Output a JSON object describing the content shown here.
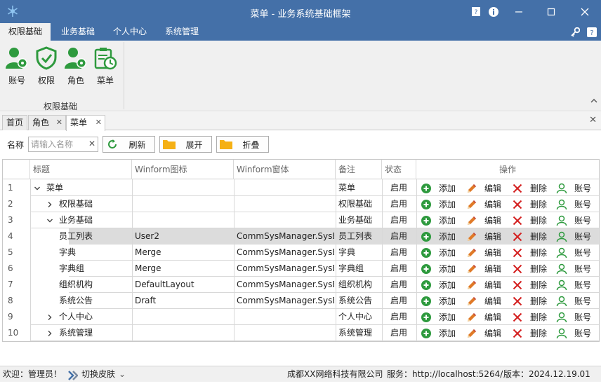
{
  "window": {
    "title": "菜单 - 业务系统基础框架"
  },
  "menu": [
    {
      "label": "权限基础",
      "active": true
    },
    {
      "label": "业务基础",
      "active": false
    },
    {
      "label": "个人中心",
      "active": false
    },
    {
      "label": "系统管理",
      "active": false
    }
  ],
  "ribbon": {
    "buttons": [
      {
        "label": "账号",
        "icon": "user-account-icon"
      },
      {
        "label": "权限",
        "icon": "shield-check-icon"
      },
      {
        "label": "角色",
        "icon": "user-role-icon"
      },
      {
        "label": "菜单",
        "icon": "menu-clock-icon"
      }
    ],
    "group_label": "权限基础"
  },
  "doc_tabs": [
    {
      "label": "首页",
      "closable": false,
      "active": false
    },
    {
      "label": "角色",
      "closable": true,
      "active": false
    },
    {
      "label": "菜单",
      "closable": true,
      "active": true
    }
  ],
  "toolbar": {
    "name_label": "名称",
    "search_placeholder": "请输入名称",
    "refresh_label": "刷新",
    "expand_label": "展开",
    "collapse_label": "折叠"
  },
  "grid": {
    "headers": {
      "title": "标题",
      "icon": "Winform图标",
      "form": "Winform窗体",
      "remark": "备注",
      "status": "状态",
      "actions": "操作"
    },
    "action_labels": {
      "add": "添加",
      "edit": "编辑",
      "delete": "删除",
      "account": "账号"
    },
    "rows": [
      {
        "num": "1",
        "level": 0,
        "toggle": "expanded",
        "title": "菜单",
        "icon": "",
        "form": "",
        "remark": "菜单",
        "status": "启用",
        "selected": false
      },
      {
        "num": "2",
        "level": 1,
        "toggle": "collapsed",
        "title": "权限基础",
        "icon": "",
        "form": "",
        "remark": "权限基础",
        "status": "启用",
        "selected": false
      },
      {
        "num": "3",
        "level": 1,
        "toggle": "expanded",
        "title": "业务基础",
        "icon": "",
        "form": "",
        "remark": "业务基础",
        "status": "启用",
        "selected": false
      },
      {
        "num": "4",
        "level": 2,
        "toggle": "none",
        "title": "员工列表",
        "icon": "User2",
        "form": "CommSysManager.SysB...",
        "remark": "员工列表",
        "status": "启用",
        "selected": true
      },
      {
        "num": "5",
        "level": 2,
        "toggle": "none",
        "title": "字典",
        "icon": "Merge",
        "form": "CommSysManager.SysB...",
        "remark": "字典",
        "status": "启用",
        "selected": false
      },
      {
        "num": "6",
        "level": 2,
        "toggle": "none",
        "title": "字典组",
        "icon": "Merge",
        "form": "CommSysManager.SysB...",
        "remark": "字典组",
        "status": "启用",
        "selected": false
      },
      {
        "num": "7",
        "level": 2,
        "toggle": "none",
        "title": "组织机构",
        "icon": "DefaultLayout",
        "form": "CommSysManager.SysB...",
        "remark": "组织机构",
        "status": "启用",
        "selected": false
      },
      {
        "num": "8",
        "level": 2,
        "toggle": "none",
        "title": "系统公告",
        "icon": "Draft",
        "form": "CommSysManager.SysB...",
        "remark": "系统公告",
        "status": "启用",
        "selected": false
      },
      {
        "num": "9",
        "level": 1,
        "toggle": "collapsed",
        "title": "个人中心",
        "icon": "",
        "form": "",
        "remark": "个人中心",
        "status": "启用",
        "selected": false
      },
      {
        "num": "10",
        "level": 1,
        "toggle": "collapsed",
        "title": "系统管理",
        "icon": "",
        "form": "",
        "remark": "系统管理",
        "status": "启用",
        "selected": false
      }
    ]
  },
  "statusbar": {
    "welcome": "欢迎：管理员！",
    "skin": "切换皮肤",
    "company": "成都XX网络科技有限公司",
    "service": "服务：http://localhost:5264/",
    "version": "版本：2024.12.19.01"
  },
  "colors": {
    "titlebar": "#4470a8",
    "green": "#2e9a3e",
    "red": "#d42020",
    "orange": "#e07a28",
    "folder": "#f5b014"
  }
}
